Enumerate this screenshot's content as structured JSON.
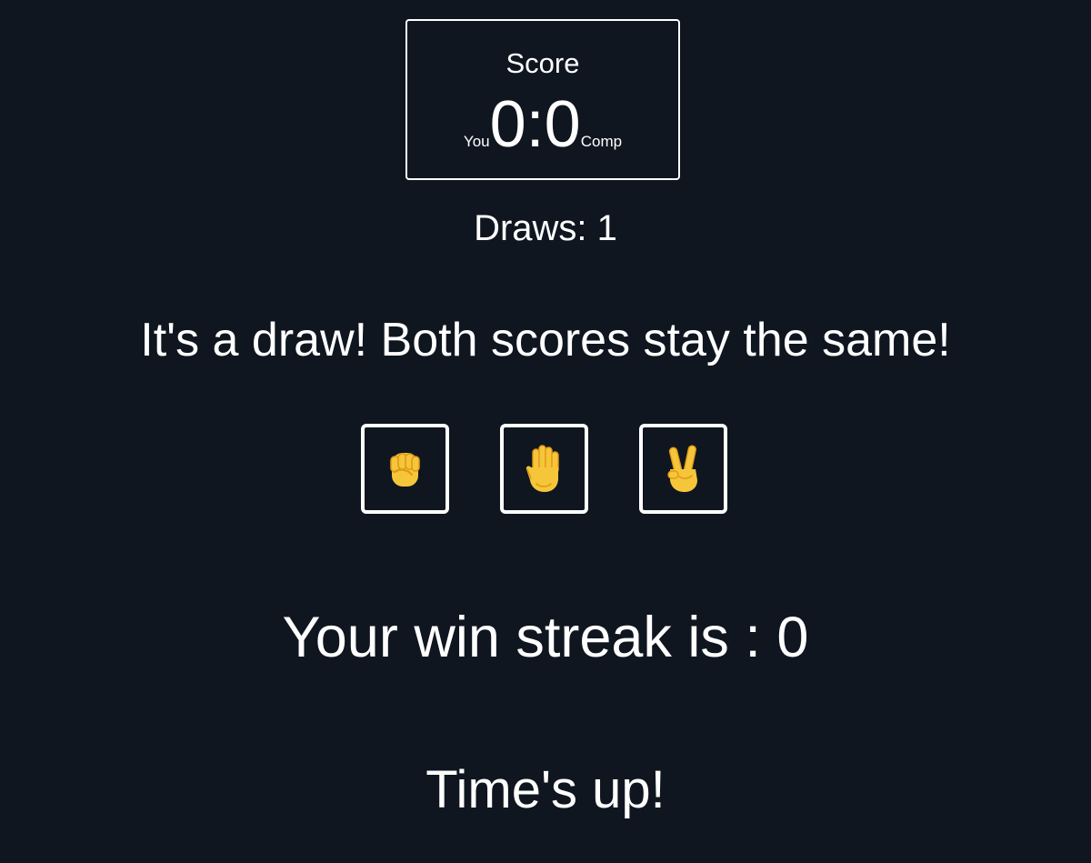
{
  "scoreboard": {
    "title": "Score",
    "player_label": "You",
    "player_score": "0",
    "separator": ":",
    "computer_score": "0",
    "computer_label": "Comp"
  },
  "draws_text": "Draws: 1",
  "result_text": "It's a draw! Both scores stay the same!",
  "choices": [
    {
      "name": "rock",
      "icon": "raised-fist-icon",
      "glyph": "✊"
    },
    {
      "name": "paper",
      "icon": "raised-hand-icon",
      "glyph": "✋"
    },
    {
      "name": "scissors",
      "icon": "victory-hand-icon",
      "glyph": "✌️"
    }
  ],
  "colors": {
    "background": "#0f1620",
    "foreground": "#ffffff",
    "emoji_skin": "#f6c63a",
    "emoji_shade": "#e09a18"
  },
  "streak_text": "Your win streak is : 0",
  "timer_text": "Time's up!"
}
